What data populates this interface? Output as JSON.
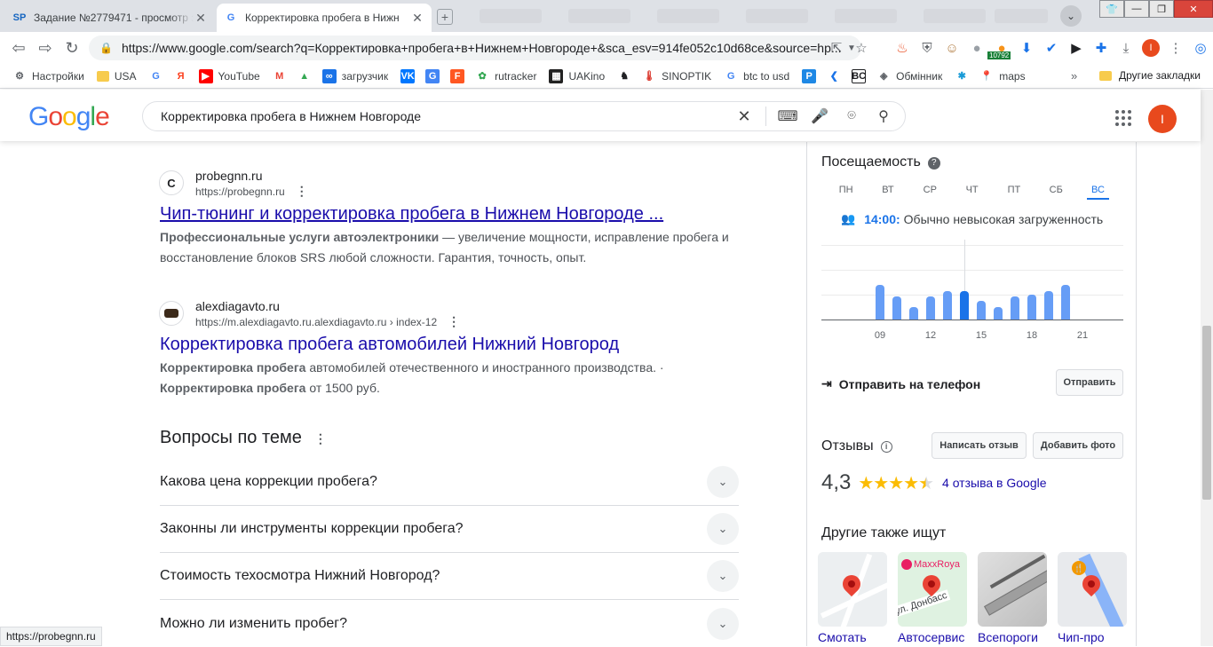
{
  "browser": {
    "tabs": [
      {
        "favicon": "SP",
        "title": "Задание №2779471 - просмотр з",
        "active": false
      },
      {
        "favicon": "G",
        "title": "Корректировка пробега в Нижн",
        "active": true
      }
    ],
    "url": "https://www.google.com/search?q=Корректировка+пробега+в+Нижнем+Новгороде+&sca_esv=914fe052c10d68ce&source=hp...",
    "extension_badge": "10792",
    "profile_letter": "I",
    "bookmarks": [
      {
        "icon": "gear-icon",
        "label": "Настройки"
      },
      {
        "icon": "folder-icon",
        "label": "USA"
      },
      {
        "icon": "google-icon",
        "label": ""
      },
      {
        "icon": "yandex-icon",
        "label": ""
      },
      {
        "icon": "youtube-icon",
        "label": "YouTube"
      },
      {
        "icon": "gmail-icon",
        "label": ""
      },
      {
        "icon": "drive-icon",
        "label": ""
      },
      {
        "icon": "infinity-icon",
        "label": "загрузчик"
      },
      {
        "icon": "vk-icon",
        "label": ""
      },
      {
        "icon": "translate-icon",
        "label": ""
      },
      {
        "icon": "f-icon",
        "label": ""
      },
      {
        "icon": "rutracker-icon",
        "label": "rutracker"
      },
      {
        "icon": "uakino-icon",
        "label": "UAKino"
      },
      {
        "icon": "chess-icon",
        "label": ""
      },
      {
        "icon": "thermometer-icon",
        "label": "SINOPTIK"
      },
      {
        "icon": "google-icon",
        "label": "btc to usd"
      },
      {
        "icon": "p-icon",
        "label": ""
      },
      {
        "icon": "arrow-icon",
        "label": ""
      },
      {
        "icon": "bc-icon",
        "label": ""
      },
      {
        "icon": "exchange-icon",
        "label": "Обмінник"
      },
      {
        "icon": "spark-icon",
        "label": ""
      },
      {
        "icon": "maps-icon",
        "label": "maps"
      }
    ],
    "other_bookmarks": "Другие закладки",
    "status_url": "https://probegnn.ru"
  },
  "google": {
    "query": "Корректировка пробега в Нижнем Новгороде",
    "results": [
      {
        "favicon": "C",
        "site": "probegnn.ru",
        "cite": "https://probegnn.ru",
        "title": "Чип-тюнинг и корректировка пробега в Нижнем Новгороде ...",
        "snippet_bold": "Профессиональные услуги автоэлектроники",
        "snippet": " — увеличение мощности, исправление пробега и восстановление блоков SRS любой сложности. Гарантия, точность, опыт."
      },
      {
        "favicon": "",
        "site": "alexdiagavto.ru",
        "cite": "https://m.alexdiagavto.ru.alexdiagavto.ru › index-12",
        "title": "Корректировка пробега автомобилей Нижний Новгород",
        "snippet_bold1": "Корректировка пробега",
        "snippet1": " автомобилей отечественного и иностранного производства. ·",
        "snippet_bold2": "Корректировка пробега",
        "snippet2": " от 1500 руб."
      }
    ],
    "paa_title": "Вопросы по теме",
    "paa": [
      "Какова цена коррекции пробега?",
      "Законны ли инструменты коррекции пробега?",
      "Стоимость техосмотра Нижний Новгород?",
      "Можно ли изменить пробег?"
    ]
  },
  "panel": {
    "popular_title": "Посещаемость",
    "days": [
      "ПН",
      "ВТ",
      "СР",
      "ЧТ",
      "ПТ",
      "СБ",
      "ВС"
    ],
    "active_day": "ВС",
    "busy_time": "14:00:",
    "busy_text": "Обычно невысокая загруженность",
    "hours_ticks": [
      "09",
      "12",
      "15",
      "18",
      "21"
    ],
    "chart_data": {
      "type": "bar",
      "categories": [
        9,
        10,
        11,
        12,
        13,
        14,
        15,
        16,
        17,
        18,
        19,
        20
      ],
      "values": [
        37,
        25,
        13,
        25,
        30,
        30,
        20,
        13,
        25,
        27,
        30,
        37
      ],
      "current_hour": 14,
      "ylim": [
        0,
        40
      ]
    },
    "send_label": "Отправить на телефон",
    "send_button": "Отправить",
    "reviews_title": "Отзывы",
    "write_review": "Написать отзыв",
    "add_photo": "Добавить фото",
    "rating": "4,3",
    "rating_value": 4.3,
    "reviews_link": "4 отзыва в Google",
    "also_title": "Другие также ищут",
    "also": [
      {
        "caption": "Смотать",
        "kind": "map"
      },
      {
        "caption": "Автосервис",
        "kind": "map",
        "overlay": "MaxxRoya",
        "street": "ул. Донбасс"
      },
      {
        "caption": "Всепороги",
        "kind": "photo"
      },
      {
        "caption": "Чип-про",
        "kind": "map"
      }
    ]
  }
}
